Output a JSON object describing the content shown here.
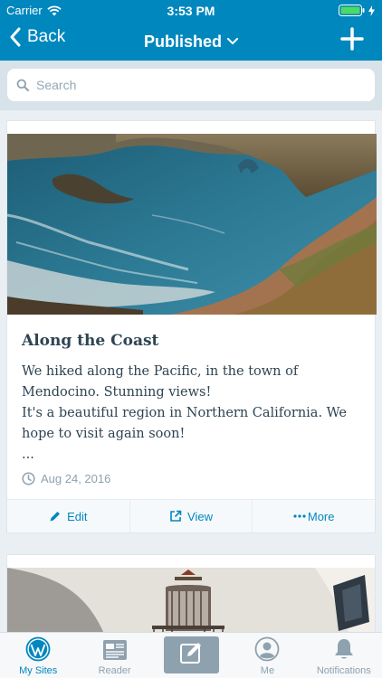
{
  "status_bar": {
    "carrier": "Carrier",
    "time": "3:53 PM"
  },
  "nav": {
    "back_label": "Back",
    "title": "Published"
  },
  "search": {
    "placeholder": "Search"
  },
  "posts": [
    {
      "title": "Along the Coast",
      "excerpt": "We hiked along the Pacific, in the town of Mendocino. Stunning views!\nIt's a beautiful region in Northern California. We hope to visit again soon!\n...",
      "date": "Aug 24, 2016"
    }
  ],
  "post_actions": {
    "edit": "Edit",
    "view": "View",
    "more": "More"
  },
  "tabbar": {
    "my_sites": "My Sites",
    "reader": "Reader",
    "me": "Me",
    "notifications": "Notifications"
  },
  "colors": {
    "primary": "#0087be",
    "muted": "#8ea1af",
    "text": "#2e4453"
  },
  "icons": [
    "wifi-icon",
    "battery-icon",
    "back-chevron-icon",
    "chevron-down-icon",
    "plus-icon",
    "search-icon",
    "clock-icon",
    "pencil-icon",
    "external-link-icon",
    "wordpress-icon",
    "reader-icon",
    "write-icon",
    "person-icon",
    "bell-icon"
  ]
}
